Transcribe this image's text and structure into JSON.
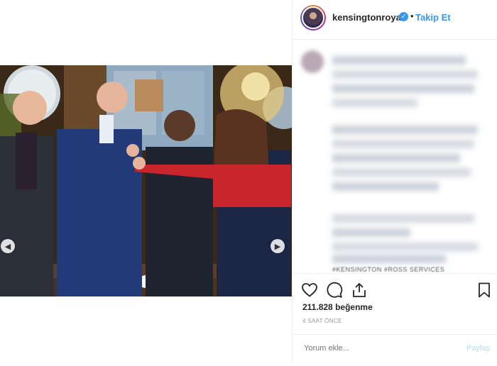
{
  "header": {
    "username": "kensingtonroyal",
    "separator": "•",
    "follow_label": "Takip Et"
  },
  "comments": {
    "partial_text": "#KENSINGTON #ROSS SERVICES"
  },
  "actions": {
    "like_icon": "heart-icon",
    "comment_icon": "comment-icon",
    "share_icon": "share-icon",
    "save_icon": "bookmark-icon"
  },
  "stats": {
    "likes_count": "211.828",
    "likes_label": "beğenme",
    "time_ago": "4 SAAT ÖNCE"
  },
  "comment_form": {
    "placeholder": "Yorum ekle...",
    "post_label": "Paylaş"
  },
  "colors": {
    "accent": "#3897f0",
    "text": "#262626",
    "muted": "#999999",
    "border": "#efefef"
  }
}
